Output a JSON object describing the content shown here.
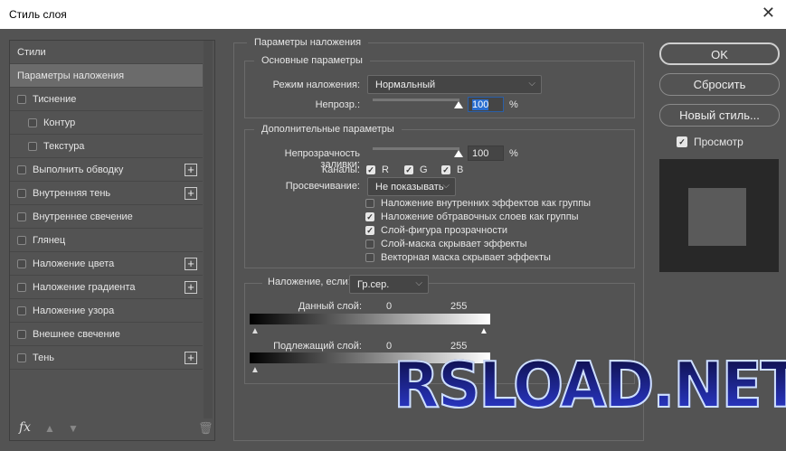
{
  "window": {
    "title": "Стиль слоя",
    "close": "✕"
  },
  "sidebar": {
    "items": [
      {
        "label": "Стили",
        "checkbox": false,
        "plus": false
      },
      {
        "label": "Параметры наложения",
        "checkbox": false,
        "plus": false,
        "selected": true
      },
      {
        "label": "Тиснение",
        "checkbox": true,
        "plus": false
      },
      {
        "label": "Контур",
        "checkbox": true,
        "plus": false,
        "indent": true
      },
      {
        "label": "Текстура",
        "checkbox": true,
        "plus": false,
        "indent": true
      },
      {
        "label": "Выполнить обводку",
        "checkbox": true,
        "plus": true
      },
      {
        "label": "Внутренняя тень",
        "checkbox": true,
        "plus": true
      },
      {
        "label": "Внутреннее свечение",
        "checkbox": true,
        "plus": false
      },
      {
        "label": "Глянец",
        "checkbox": true,
        "plus": false
      },
      {
        "label": "Наложение цвета",
        "checkbox": true,
        "plus": true
      },
      {
        "label": "Наложение градиента",
        "checkbox": true,
        "plus": true
      },
      {
        "label": "Наложение узора",
        "checkbox": true,
        "plus": false
      },
      {
        "label": "Внешнее свечение",
        "checkbox": true,
        "plus": false
      },
      {
        "label": "Тень",
        "checkbox": true,
        "plus": true
      }
    ],
    "fx": "fx"
  },
  "main": {
    "title": "Параметры наложения",
    "basic": {
      "title": "Основные параметры",
      "blend_mode_label": "Режим наложения:",
      "blend_mode": "Нормальный",
      "opacity_label": "Непрозр.:",
      "opacity": "100",
      "pct": "%"
    },
    "advanced": {
      "title": "Дополнительные параметры",
      "fill_label": "Непрозрачность заливки:",
      "fill": "100",
      "pct": "%",
      "channels_label": "Каналы:",
      "r": "R",
      "g": "G",
      "b": "B",
      "knockout_label": "Просвечивание:",
      "knockout": "Не показывать",
      "options": [
        {
          "label": "Наложение внутренних эффектов как группы",
          "checked": false
        },
        {
          "label": "Наложение обтравочных слоев как группы",
          "checked": true
        },
        {
          "label": "Слой-фигура прозрачности",
          "checked": true
        },
        {
          "label": "Слой-маска скрывает эффекты",
          "checked": false
        },
        {
          "label": "Векторная маска скрывает эффекты",
          "checked": false
        }
      ]
    },
    "blendif": {
      "label": "Наложение, если:",
      "value": "Гр.сер.",
      "this_layer": "Данный слой:",
      "underlying": "Подлежащий слой:",
      "min": "0",
      "max": "255"
    }
  },
  "buttons": {
    "ok": "OK",
    "reset": "Сбросить",
    "new_style": "Новый стиль...",
    "preview": "Просмотр"
  },
  "watermark": "RSLOAD.NET"
}
